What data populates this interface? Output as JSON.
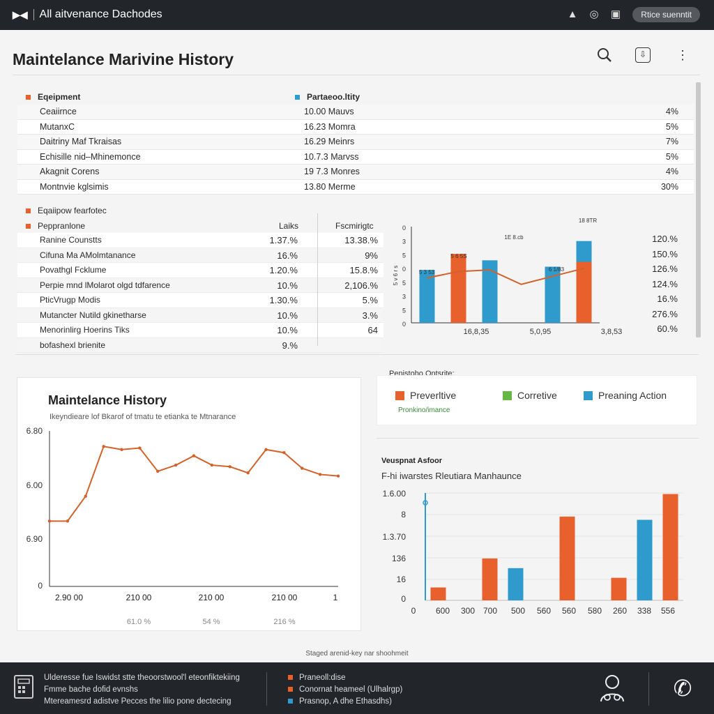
{
  "app": {
    "title": "All aitvenance Dachodes",
    "logo": "▶◀",
    "action_button": "Rtice suenntit"
  },
  "page": {
    "title": "Maintelance Marivine History"
  },
  "equipment_table": {
    "legend": [
      {
        "label": "Eqeipment",
        "color": "#e8602c"
      },
      {
        "label": "Partaeoo.ltity",
        "color": "#2e9bcc"
      }
    ],
    "rows": [
      {
        "name": "Ceaiirnce",
        "value": "10.00 Mauvs",
        "pct": "4%"
      },
      {
        "name": "MutanxC",
        "value": "16.23 Momra",
        "pct": "5%"
      },
      {
        "name": "Daitriny Maf Tkraisas",
        "value": "16.29 Meinrs",
        "pct": "7%"
      },
      {
        "name": "Echisille nid–Mhinemonce",
        "value": "10.7.3 Marvss",
        "pct": "5%"
      },
      {
        "name": "Akagnit Corens",
        "value": "19 7.3 Monres",
        "pct": "4%"
      },
      {
        "name": "Montnvie kglsimis",
        "value": "13.80 Merme",
        "pct": "30%"
      }
    ]
  },
  "performance_table": {
    "legend": [
      {
        "label": "Eqaiipow fearfotec",
        "color": "#e8602c"
      },
      {
        "label": "Peppranlone",
        "color": "#e8602c"
      }
    ],
    "col1": "Laiks",
    "col2": "Fscmirigtc",
    "rows": [
      {
        "name": "Ranine Counstts",
        "a": "1.37.%",
        "b": "13.38.%"
      },
      {
        "name": "Cifuna Ma AMolmtanance",
        "a": "16.%",
        "b": "9%"
      },
      {
        "name": "Povathgl Fcklume",
        "a": "1.20.%",
        "b": "15.8.%"
      },
      {
        "name": "Perpie mnd lMolarot olgd tdfarence",
        "a": "10.%",
        "b": "2,106.%"
      },
      {
        "name": "PticVrugp Modis",
        "a": "1.30.%",
        "b": "5.%"
      },
      {
        "name": "Mutancter Nutild gkinetharse",
        "a": "10.%",
        "b": "3.%"
      },
      {
        "name": "Menorinlirg Hoerins Tiks",
        "a": "10.%",
        "b": "64"
      },
      {
        "name": "bofashexl brienite",
        "a": "9.%",
        "b": ""
      }
    ],
    "right_pct": [
      "120.%",
      "150.%",
      "126.%",
      "124.%",
      "16.%",
      "276.%",
      "60.%"
    ]
  },
  "history": {
    "title": "Maintelance History",
    "subtitle": "Ikeyndieare lof Bkarof of tmatu te etianka te Mtnarance"
  },
  "legend_panel": {
    "heading": "Penistoho Ontsrite:",
    "items": [
      {
        "label": "Preverltive",
        "color": "#e8602c"
      },
      {
        "label": "Corretive",
        "color": "#66b845"
      },
      {
        "label": "Preaning Action",
        "color": "#2e9bcc"
      }
    ],
    "sub": "Pronkino/imance"
  },
  "vertical_panel": {
    "title": "Veuspnat Asfoor",
    "subtitle": "F-hi iwarstes Rleutiara Manhaunce"
  },
  "caption": "Staged arenid-key nar shoohmeit",
  "footer": {
    "lines": [
      "Ulderesse fue Iswidst stte theoorstwool'l eteonfiktekiing",
      "Fmme bache dofid evnshs",
      "Mtereamesrd adistve Pecces the lilio pone dectecing"
    ],
    "legend": [
      {
        "label": "Praneoll:dise",
        "color": "#e8602c"
      },
      {
        "label": "Conornat heameel (Ulhalrgp)",
        "color": "#e8602c"
      },
      {
        "label": "Prasnop, A dhe Ethasdhs)",
        "color": "#2e9bcc"
      }
    ]
  },
  "chart_data": [
    {
      "type": "bar",
      "title": "",
      "categories": [
        "1",
        "2",
        "3",
        "4",
        "5",
        "6"
      ],
      "series": [
        {
          "name": "",
          "color": "#2e9bcc",
          "values": [
            3.3,
            null,
            3.9,
            null,
            3.5,
            5.1
          ]
        },
        {
          "name": "",
          "color": "#e8602c",
          "values": [
            null,
            4.3,
            null,
            null,
            null,
            3.8
          ]
        }
      ],
      "overlay_line": [
        2.8,
        3.2,
        3.3,
        2.4,
        2.9,
        3.4
      ],
      "value_labels": [
        "5 3 53",
        "5 6 5S",
        "1E 8.cb",
        "6 1/83",
        "18 8TR"
      ],
      "x_tick_labels": [
        "16,8,35",
        "5,0,95",
        "3,8,53"
      ],
      "y_tick_labels": [
        "0",
        "5",
        "3",
        "5",
        "0",
        "5",
        "3",
        "0"
      ],
      "ylabel": "5 v 6 r s"
    },
    {
      "type": "line",
      "title": "Maintelance History",
      "x": [
        0,
        1,
        2,
        3,
        4,
        5,
        6,
        7,
        8,
        9,
        10,
        11,
        12,
        13,
        14,
        15,
        16
      ],
      "y_scale": [
        0,
        1
      ],
      "series": [
        {
          "name": "",
          "color": "#d2622b",
          "values": [
            0.42,
            0.42,
            0.58,
            0.9,
            0.88,
            0.89,
            0.74,
            0.78,
            0.84,
            0.78,
            0.77,
            0.73,
            0.88,
            0.86,
            0.76,
            0.72,
            0.71
          ]
        }
      ],
      "y_tick_labels": [
        "6.80",
        "6.00",
        "6.90",
        "0"
      ],
      "x_tick_labels": [
        "2.90 00",
        "210 00",
        "210 00",
        "210 00",
        "1"
      ],
      "bottom_labels": [
        "61.0 %",
        "54 %",
        "216 %"
      ]
    },
    {
      "type": "bar",
      "title": "F-hi iwarstes Rleutiara Manhaunce",
      "categories": [
        "600",
        "300",
        "700",
        "500",
        "560",
        "560",
        "580",
        "260",
        "338",
        "556"
      ],
      "series": [
        {
          "name": "",
          "color": "#e8602c",
          "values": [
            0.12,
            null,
            0.39,
            null,
            null,
            0.78,
            null,
            0.21,
            null,
            0.99
          ]
        },
        {
          "name": "",
          "color": "#2e9bcc",
          "values": [
            null,
            null,
            null,
            0.3,
            null,
            null,
            null,
            null,
            0.75,
            null
          ]
        }
      ],
      "y_tick_labels": [
        "1.6.00",
        "8",
        "1.3.70",
        "136",
        "16",
        "0"
      ],
      "x_tick_labels": [
        "0",
        "600",
        "300",
        "700",
        "500",
        "560",
        "560",
        "580",
        "260",
        "338",
        "556"
      ]
    }
  ]
}
